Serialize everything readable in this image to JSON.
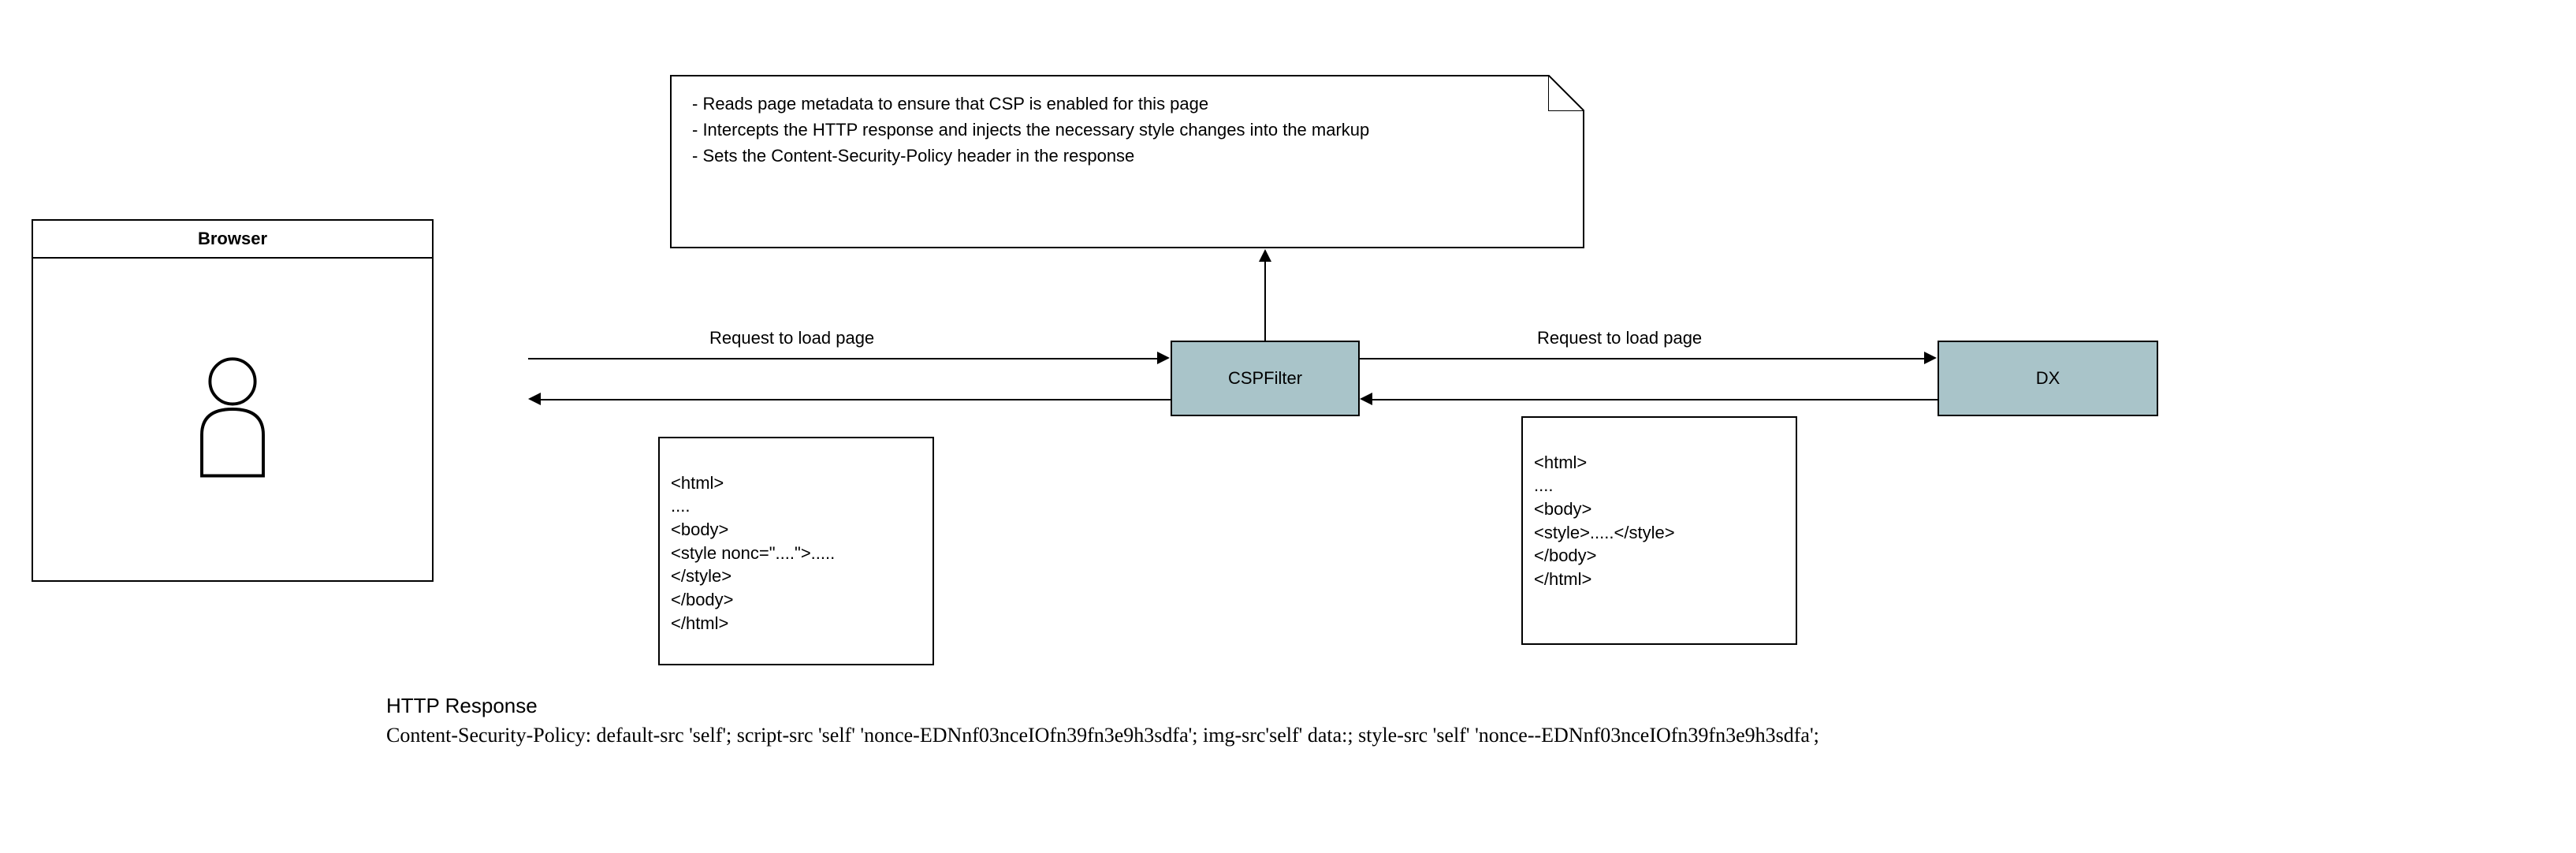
{
  "browser": {
    "title": "Browser"
  },
  "note": {
    "line1": "- Reads page metadata to ensure that CSP is enabled for this page",
    "line2": "- Intercepts the HTTP response and injects the necessary style changes into the markup",
    "line3": "- Sets the Content-Security-Policy header in the response"
  },
  "filter": {
    "label": "CSPFilter"
  },
  "dx": {
    "label": "DX"
  },
  "arrows": {
    "request_left": "Request to load page",
    "request_right": "Request to load page"
  },
  "left_code": {
    "l1": "<html>",
    "l2": "....",
    "l3": "<body>",
    "l4": "<style nonc=\"....\">.....",
    "l5": "</style>",
    "l6": "</body>",
    "l7": "</html>"
  },
  "right_code": {
    "l1": "<html>",
    "l2": "....",
    "l3": "<body>",
    "l4": "<style>.....</style>",
    "l5": "</body>",
    "l6": "</html>"
  },
  "footer": {
    "line1": "HTTP Response",
    "line2": "Content-Security-Policy: default-src 'self'; script-src 'self' 'nonce-EDNnf03nceIOfn39fn3e9h3sdfa'; img-src'self' data:; style-src 'self' 'nonce--EDNnf03nceIOfn39fn3e9h3sdfa';"
  }
}
